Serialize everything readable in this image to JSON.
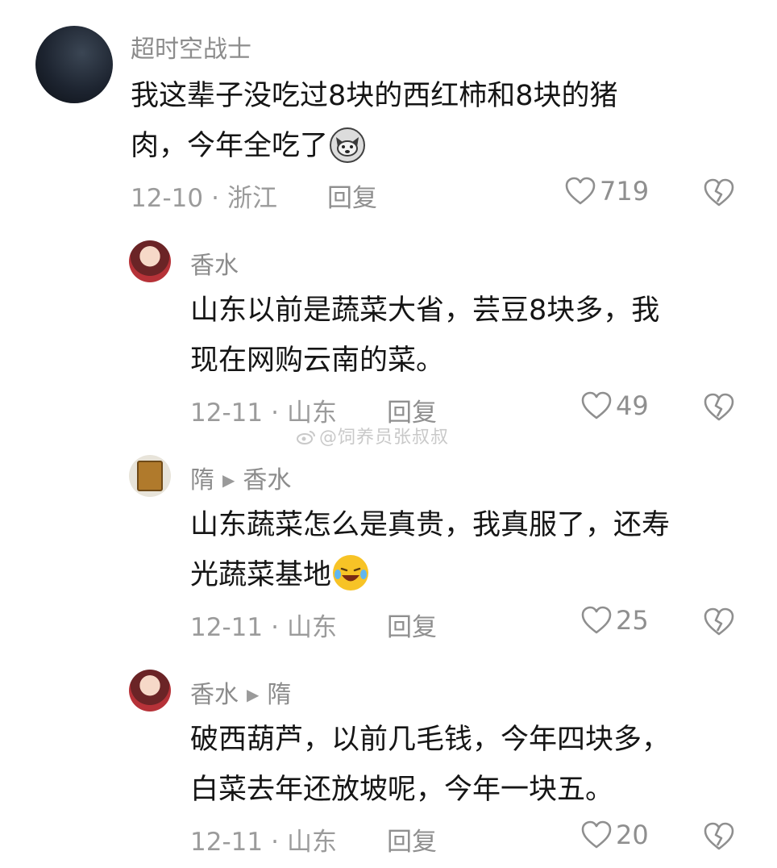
{
  "watermark": "@饲养员张叔叔",
  "comments": [
    {
      "username": "超时空战士",
      "text_line1": "我这辈子没吃过8块的西红柿和8块的猪",
      "text_line2": "肉，今年全吃了",
      "emoji": "wolf-emoji",
      "date": "12-10",
      "dot": "·",
      "location": "浙江",
      "reply_label": "回复",
      "likes": "719"
    },
    {
      "username": "香水",
      "text_line1": "山东以前是蔬菜大省，芸豆8块多，我",
      "text_line2": "现在网购云南的菜。",
      "date": "12-11",
      "dot": "·",
      "location": "山东",
      "reply_label": "回复",
      "likes": "49"
    },
    {
      "username": "隋",
      "reply_to": "香水",
      "text_line1": "山东蔬菜怎么是真贵，我真服了，还寿",
      "text_line2": "光蔬菜基地",
      "emoji": "crying-laughing-emoji",
      "date": "12-11",
      "dot": "·",
      "location": "山东",
      "reply_label": "回复",
      "likes": "25"
    },
    {
      "username": "香水",
      "reply_to": "隋",
      "text_line1": "破西葫芦，以前几毛钱，今年四块多，",
      "text_line2": "白菜去年还放坡呢，今年一块五。",
      "date": "12-11",
      "dot": "·",
      "location": "山东",
      "reply_label": "回复",
      "likes": "20"
    }
  ],
  "colors": {
    "text": "#151515",
    "meta": "#9b9b9b",
    "icon": "#8f8f8f"
  }
}
